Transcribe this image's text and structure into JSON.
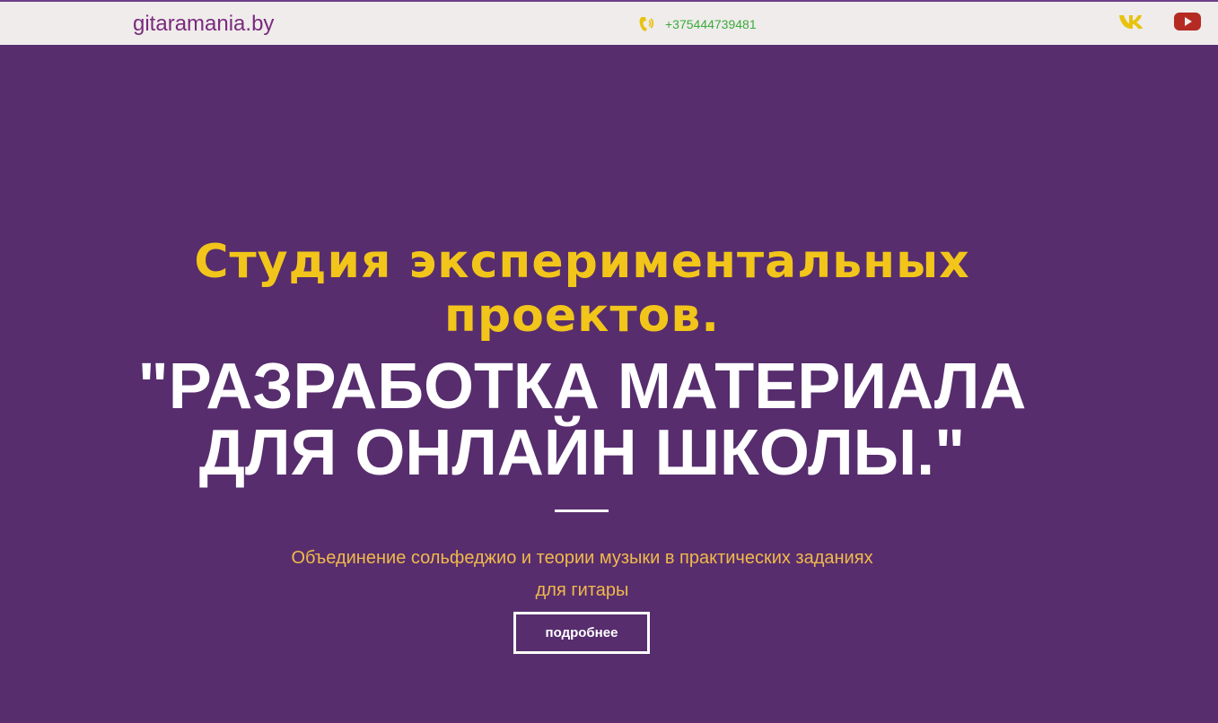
{
  "header": {
    "logo": "gitaramania.by",
    "phone": "+375444739481",
    "social": [
      {
        "name": "vk-icon",
        "color": "#e8c20e"
      },
      {
        "name": "youtube-icon",
        "color": "#b52a22"
      }
    ]
  },
  "hero": {
    "subtitle": "Студия экспериментальных проектов.",
    "title": "\"РАЗРАБОТКА МАТЕРИАЛА ДЛЯ ОНЛАЙН ШКОЛЫ.\"",
    "description": "Объединение сольфеджио и теории музыки в практических заданиях для гитары",
    "button_label": "подробнее"
  },
  "colors": {
    "background": "#572d6e",
    "header_bg": "#efeceb",
    "subtitle": "#f2c51a",
    "description": "#f1b94a",
    "phone_text": "#3caa3c",
    "logo": "#7a2a7e"
  }
}
